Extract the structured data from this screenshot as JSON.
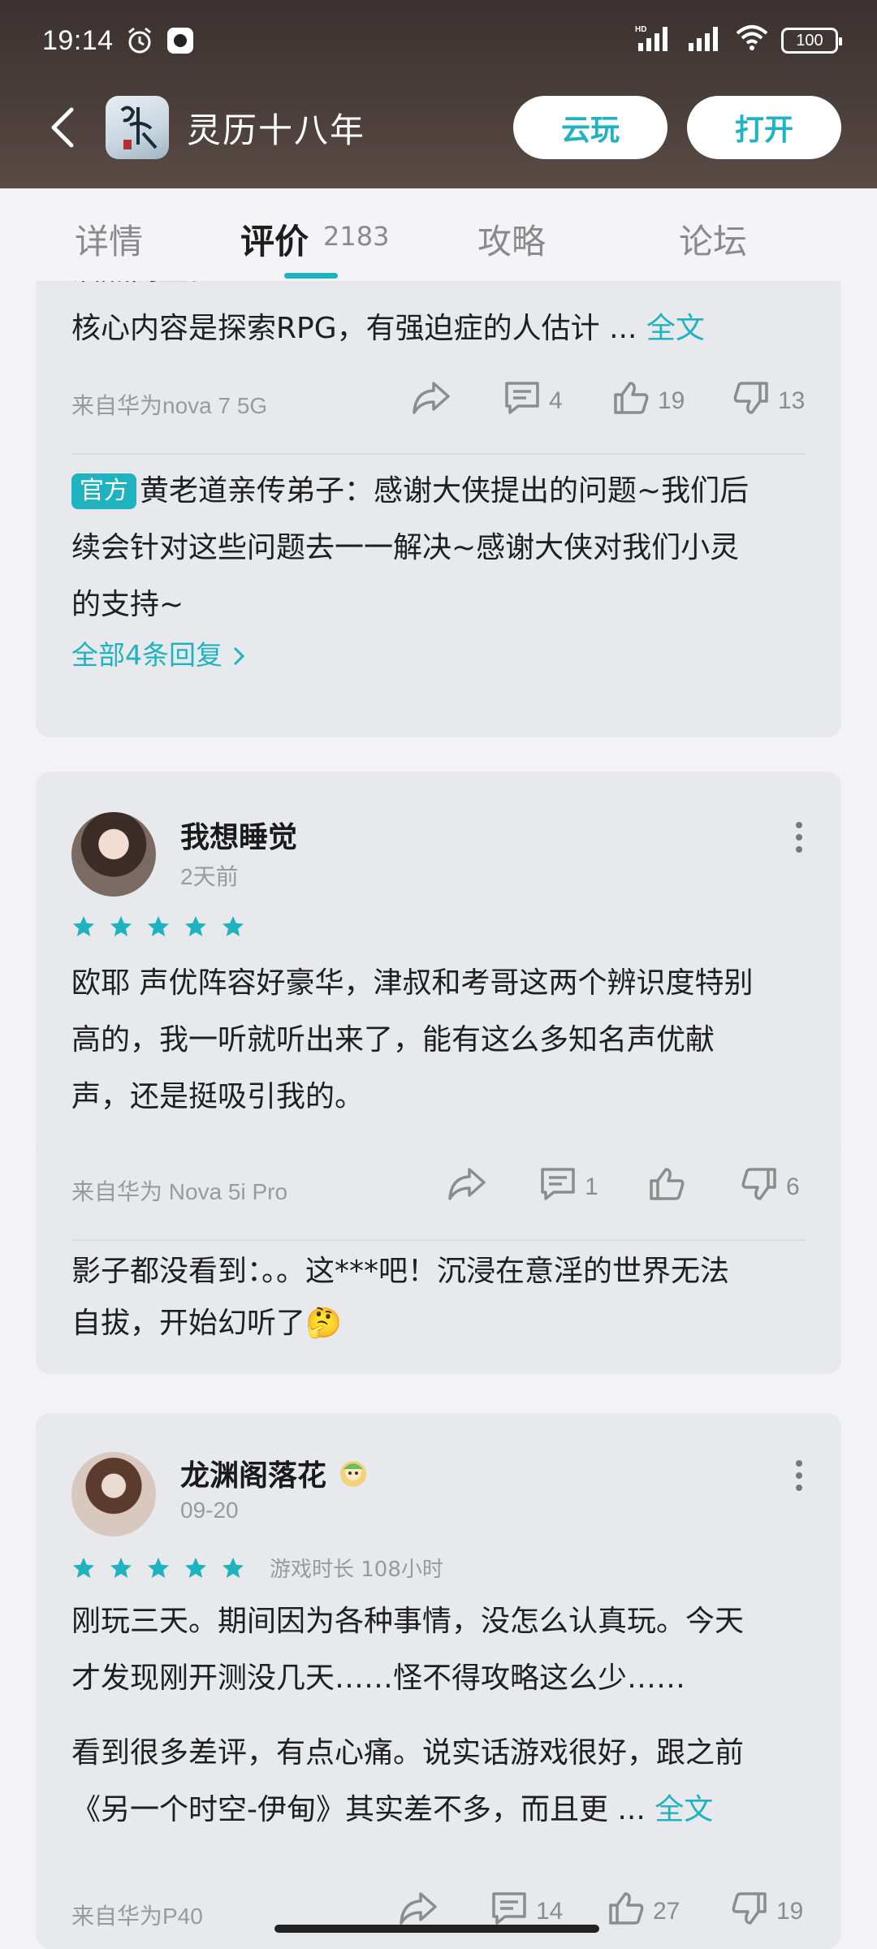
{
  "status_bar": {
    "time": "19:14",
    "battery": "100",
    "network": "HD"
  },
  "app_bar": {
    "title": "灵历十八年",
    "cloud_play": "云玩",
    "open": "打开",
    "logo_text": "灵历十八年"
  },
  "tabs": [
    {
      "label": "详情"
    },
    {
      "label": "评价",
      "count": "2183",
      "active": true
    },
    {
      "label": "攻略"
    },
    {
      "label": "论坛"
    }
  ],
  "review1": {
    "partial_line": "油然而生。",
    "text": "核心内容是探索RPG，有强迫症的人估计 ...",
    "full_text_link": "全文",
    "device": "来自华为nova 7 5G",
    "comments": "4",
    "likes": "19",
    "dislikes": "13",
    "official_badge": "官方",
    "reply_line1": "黄老道亲传弟子：感谢大侠提出的问题~我们后",
    "reply_line2": "续会针对这些问题去一一解决~感谢大侠对我们小灵",
    "reply_line3": "的支持~",
    "all_replies": "全部4条回复"
  },
  "review2": {
    "username": "我想睡觉",
    "date": "2天前",
    "stars": 5,
    "line1": "欧耶 声优阵容好豪华，津叔和考哥这两个辨识度特别",
    "line2": "高的，我一听就听出来了，能有这么多知名声优献",
    "line3": "声，还是挺吸引我的。",
    "device": "来自华为 Nova 5i Pro",
    "comments": "1",
    "likes": "",
    "dislikes": "6",
    "reply_line1": "影子都没看到：。。这***吧！沉浸在意淫的世界无法",
    "reply_line2": "自拔，开始幻听了🤔"
  },
  "review3": {
    "username": "龙渊阁落花",
    "date": "09-20",
    "stars": 5,
    "playtime": "游戏时长 108小时",
    "line1": "刚玩三天。期间因为各种事情，没怎么认真玩。今天",
    "line2": "才发现刚开测没几天……怪不得攻略这么少……",
    "line3": "看到很多差评，有点心痛。说实话游戏很好，跟之前",
    "line4": "《另一个时空-伊甸》其实差不多，而且更 ...",
    "full_text_link": "全文",
    "device": "来自华为P40",
    "comments": "14",
    "likes": "27",
    "dislikes": "19"
  },
  "colors": {
    "accent": "#1fb2bf",
    "header_bg": "#3f3533",
    "card_bg": "#e8e9ed"
  }
}
